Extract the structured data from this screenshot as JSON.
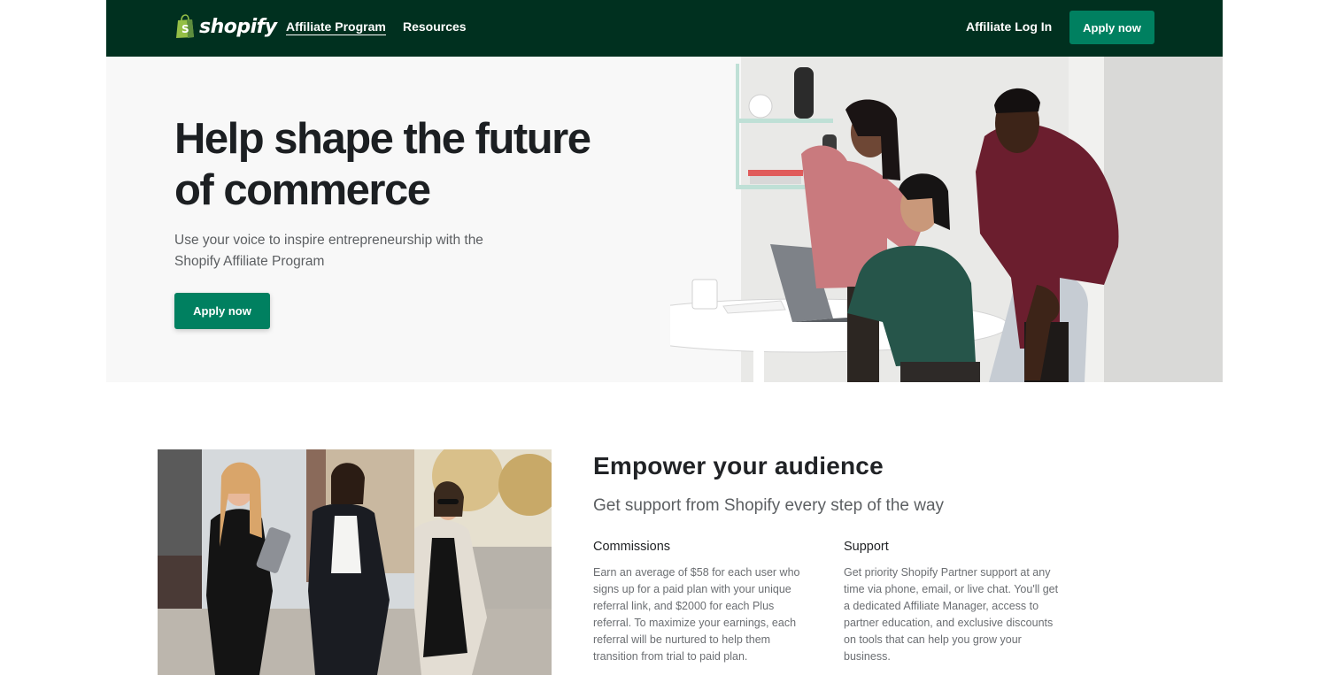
{
  "header": {
    "brand": "shopify",
    "nav": {
      "affiliate_program": "Affiliate Program",
      "resources": "Resources"
    },
    "login": "Affiliate Log In",
    "apply": "Apply now"
  },
  "hero": {
    "title_line1": "Help shape the future",
    "title_line2": "of commerce",
    "subtitle_line1": "Use your voice to inspire entrepreneurship with the",
    "subtitle_line2": "Shopify Affiliate Program",
    "cta": "Apply now"
  },
  "empower": {
    "title": "Empower your audience",
    "subtitle": "Get support from Shopify every step of the way",
    "features": [
      {
        "title": "Commissions",
        "body": "Earn an average of $58 for each user who signs up for a paid plan with your unique referral link, and $2000 for each Plus referral. To maximize your earnings, each referral will be nurtured to help them transition from trial to paid plan."
      },
      {
        "title": "Support",
        "body": "Get priority Shopify Partner support at any time via phone, email, or live chat. You'll get a dedicated Affiliate Manager, access to partner education, and exclusive discounts on tools that can help you grow your business."
      }
    ]
  },
  "colors": {
    "header_bg": "#00301f",
    "accent": "#008060",
    "hero_bg": "#f8f8f8"
  }
}
